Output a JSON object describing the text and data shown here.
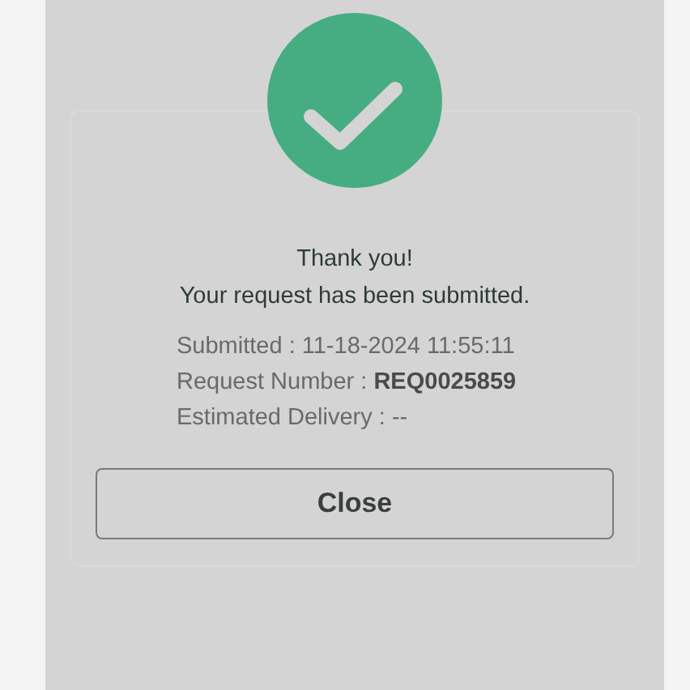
{
  "dialog": {
    "heading": "Thank you!",
    "message": "Your request has been submitted.",
    "details": [
      "Submitted : 11-18-2024 11:55:11",
      "Request Number : **REQ0025859**",
      "Estimated Delivery : --"
    ],
    "buttons": [
      "Close"
    ]
  }
}
